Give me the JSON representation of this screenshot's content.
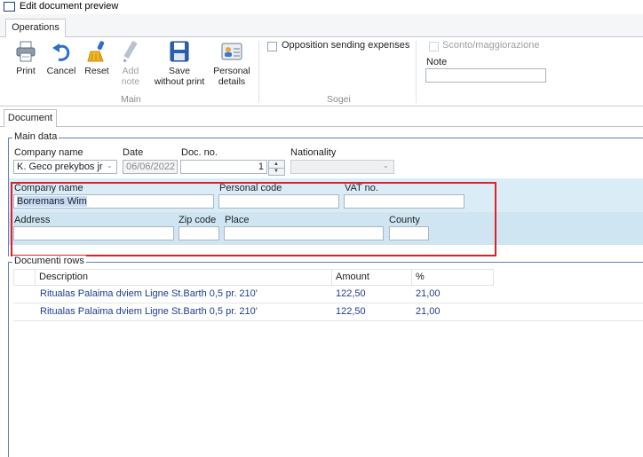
{
  "window": {
    "title": "Edit document preview"
  },
  "ribbon": {
    "tab": "Operations",
    "buttons": {
      "print": "Print",
      "cancel": "Cancel",
      "reset": "Reset",
      "add_note_1": "Add",
      "add_note_2": "note",
      "save_1": "Save",
      "save_2": "without print",
      "personal_1": "Personal",
      "personal_2": "details"
    },
    "groups": {
      "main": "Main",
      "sogei": "Sogei"
    },
    "opposition_label": "Opposition sending expenses",
    "sconto_label": "Sconto/maggiorazione",
    "note_label": "Note",
    "note_value": ""
  },
  "document_tab": "Document",
  "main_data": {
    "legend": "Main data",
    "company_name_label": "Company name",
    "company_name_value": "K. Geco prekybos jr",
    "date_label": "Date",
    "date_value": "06/06/2022",
    "doc_no_label": "Doc. no.",
    "doc_no_value": "1",
    "nationality_label": "Nationality",
    "nationality_value": "",
    "customer": {
      "company_name_label": "Company name",
      "company_name_value": "Borremans Wim",
      "personal_code_label": "Personal code",
      "personal_code_value": "",
      "vat_label": "VAT no.",
      "vat_value": "",
      "address_label": "Address",
      "address_value": "",
      "zip_label": "Zip code",
      "zip_value": "",
      "place_label": "Place",
      "place_value": "",
      "county_label": "County",
      "county_value": ""
    }
  },
  "rows": {
    "legend": "Documenti rows",
    "columns": [
      "Description",
      "Amount",
      "%"
    ],
    "items": [
      {
        "description": "Ritualas Palaima dviem Ligne St.Barth 0,5 pr. 210'",
        "amount": "122,50",
        "percent": "21,00"
      },
      {
        "description": "Ritualas Palaima dviem Ligne St.Barth 0,5 pr. 210'",
        "amount": "122,50",
        "percent": "21,00"
      }
    ]
  },
  "colors": {
    "highlight": "#e01f26",
    "accent": "#1f3d8f",
    "band": "#daecf6"
  }
}
